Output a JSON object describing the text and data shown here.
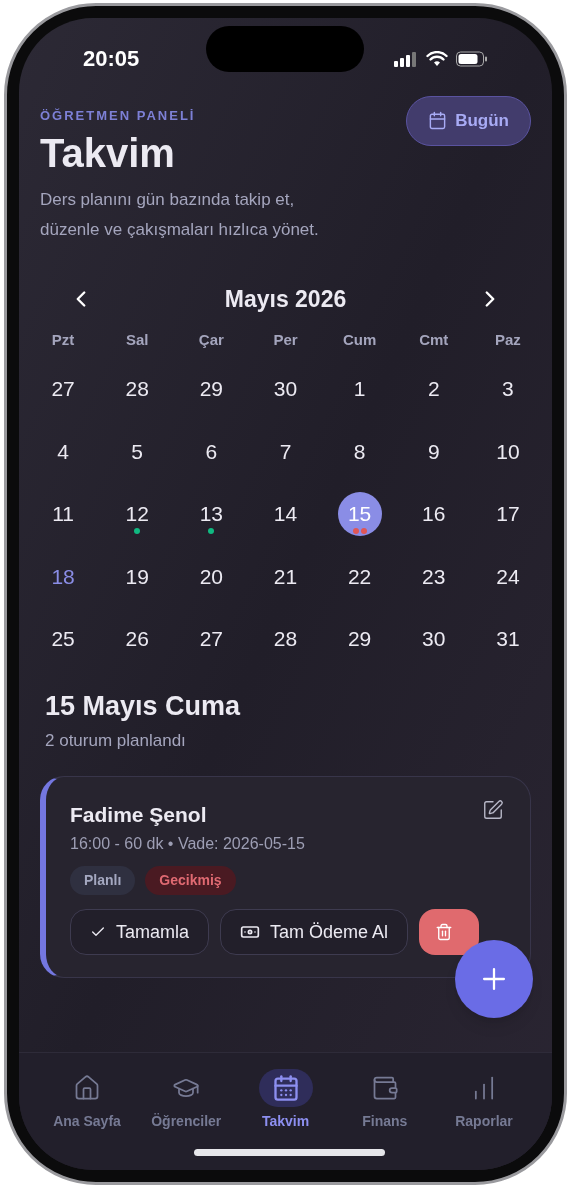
{
  "status_bar": {
    "time": "20:05"
  },
  "header": {
    "eyebrow": "ÖĞRETMEN PANELİ",
    "title": "Takvim",
    "description": "Ders planını gün bazında takip et, düzenle ve çakışmaları hızlıca yönet.",
    "today_button": "Bugün"
  },
  "calendar": {
    "month": "Mayıs 2026",
    "weekdays": [
      "Pzt",
      "Sal",
      "Çar",
      "Per",
      "Cum",
      "Cmt",
      "Paz"
    ],
    "days": [
      {
        "label": "27",
        "selected": false,
        "today": false
      },
      {
        "label": "28",
        "selected": false,
        "today": false
      },
      {
        "label": "29",
        "selected": false,
        "today": false
      },
      {
        "label": "30",
        "selected": false,
        "today": false
      },
      {
        "label": "1",
        "selected": false,
        "today": false
      },
      {
        "label": "2",
        "selected": false,
        "today": false
      },
      {
        "label": "3",
        "selected": false,
        "today": false
      },
      {
        "label": "4",
        "selected": false,
        "today": false
      },
      {
        "label": "5",
        "selected": false,
        "today": false
      },
      {
        "label": "6",
        "selected": false,
        "today": false
      },
      {
        "label": "7",
        "selected": false,
        "today": false
      },
      {
        "label": "8",
        "selected": false,
        "today": false
      },
      {
        "label": "9",
        "selected": false,
        "today": false
      },
      {
        "label": "10",
        "selected": false,
        "today": false
      },
      {
        "label": "11",
        "selected": false,
        "today": false
      },
      {
        "label": "12",
        "selected": false,
        "today": false,
        "dots": [
          {
            "color": "#10b981"
          }
        ]
      },
      {
        "label": "13",
        "selected": false,
        "today": false,
        "dots": [
          {
            "color": "#10b981"
          }
        ]
      },
      {
        "label": "14",
        "selected": false,
        "today": false
      },
      {
        "label": "15",
        "selected": true,
        "today": false,
        "dots": [
          {
            "color": "#e05656"
          },
          {
            "color": "#e05656"
          }
        ]
      },
      {
        "label": "16",
        "selected": false,
        "today": false
      },
      {
        "label": "17",
        "selected": false,
        "today": false
      },
      {
        "label": "18",
        "selected": false,
        "today": true
      },
      {
        "label": "19",
        "selected": false,
        "today": false
      },
      {
        "label": "20",
        "selected": false,
        "today": false
      },
      {
        "label": "21",
        "selected": false,
        "today": false
      },
      {
        "label": "22",
        "selected": false,
        "today": false
      },
      {
        "label": "23",
        "selected": false,
        "today": false
      },
      {
        "label": "24",
        "selected": false,
        "today": false
      },
      {
        "label": "25",
        "selected": false,
        "today": false
      },
      {
        "label": "26",
        "selected": false,
        "today": false
      },
      {
        "label": "27",
        "selected": false,
        "today": false
      },
      {
        "label": "28",
        "selected": false,
        "today": false
      },
      {
        "label": "29",
        "selected": false,
        "today": false
      },
      {
        "label": "30",
        "selected": false,
        "today": false
      },
      {
        "label": "31",
        "selected": false,
        "today": false
      }
    ]
  },
  "day_section": {
    "title": "15 Mayıs Cuma",
    "subtitle": "2 oturum planlandı"
  },
  "sessions": [
    {
      "name": "Fadime Şenol",
      "meta": "16:00 - 60 dk • Vade: 2026-05-15",
      "tags": [
        {
          "label": "Planlı",
          "kind": "neutral"
        },
        {
          "label": "Gecikmiş",
          "kind": "danger"
        }
      ],
      "actions": [
        {
          "label": "Tamamla",
          "kind": "complete"
        },
        {
          "label": "Tam Ödeme Al",
          "kind": "payment"
        }
      ]
    }
  ],
  "tab_bar": [
    {
      "label": "Ana Sayfa",
      "kind": "home",
      "selected": false
    },
    {
      "label": "Öğrenciler",
      "kind": "students",
      "selected": false
    },
    {
      "label": "Takvim",
      "kind": "calendar",
      "selected": true
    },
    {
      "label": "Finans",
      "kind": "wallet",
      "selected": false
    },
    {
      "label": "Raporlar",
      "kind": "chart",
      "selected": false
    }
  ]
}
